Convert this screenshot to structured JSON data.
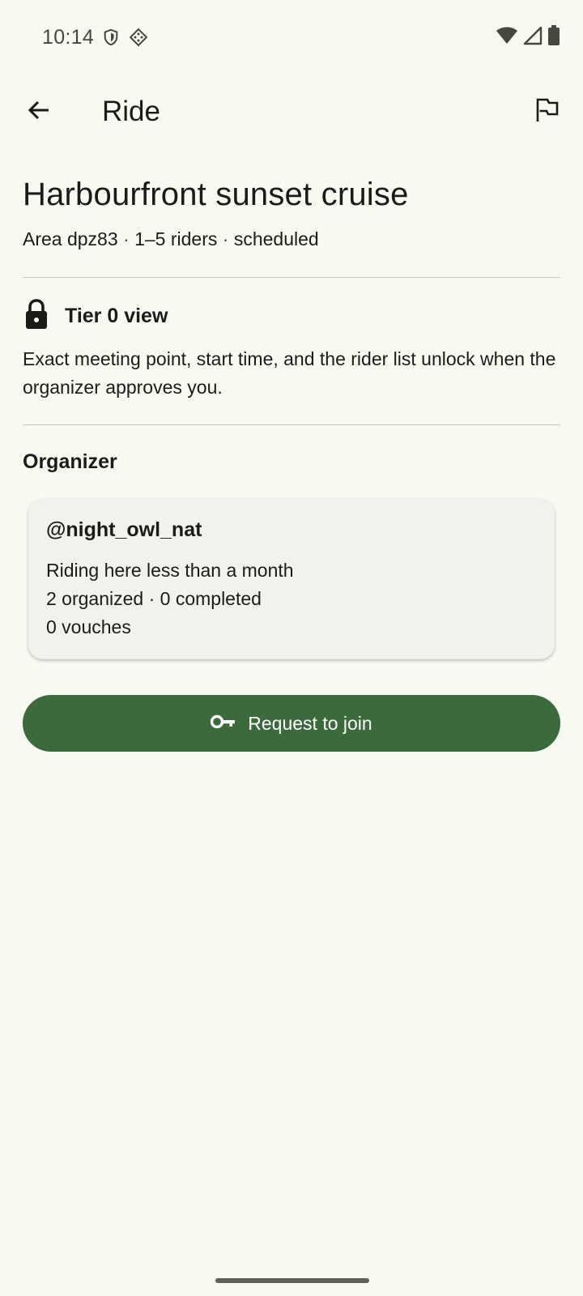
{
  "status_bar": {
    "time": "10:14",
    "icons": [
      "shield-icon",
      "diamond-dot-icon",
      "wifi-icon",
      "signal-icon",
      "battery-icon"
    ]
  },
  "app_bar": {
    "title": "Ride",
    "icons": [
      "back-arrow-icon",
      "flag-icon"
    ]
  },
  "ride": {
    "title": "Harbourfront sunset cruise",
    "area": "Area dpz83",
    "riders": "1–5 riders",
    "status": "scheduled",
    "separator": "·"
  },
  "tier": {
    "icon": "lock-icon",
    "label": "Tier 0 view",
    "description": "Exact meeting point, start time, and the rider list unlock when the organizer approves you."
  },
  "organizer": {
    "section_title": "Organizer",
    "handle": "@night_owl_nat",
    "tenure": "Riding here less than a month",
    "stats": "2 organized · 0 completed",
    "vouches": "0 vouches"
  },
  "actions": {
    "join_label": "Request to join",
    "join_icon": "key-icon"
  },
  "colors": {
    "background": "#f8faf2",
    "primary": "#3b6a3d",
    "card": "#f0f2ec",
    "divider": "#c5c8ba",
    "text": "#1b1c18"
  }
}
